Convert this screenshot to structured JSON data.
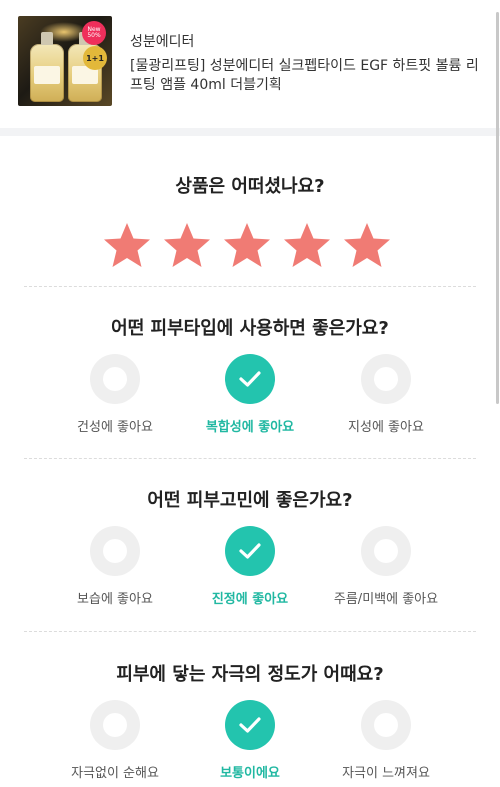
{
  "product": {
    "brand": "성분에디터",
    "name": "[물광리프팅] 성분에디터 실크펩타이드 EGF 하트핏 볼륨 리프팅 앰플 40ml 더블기획",
    "badge_new": "New 50%",
    "badge_plus": "1+1"
  },
  "rating": {
    "question": "상품은 어떠셨나요?",
    "value": 5,
    "max": 5,
    "star_color": "#f07b74"
  },
  "questions": [
    {
      "question": "어떤 피부타입에 사용하면 좋은가요?",
      "options": [
        {
          "label": "건성에 좋아요",
          "selected": false
        },
        {
          "label": "복합성에 좋아요",
          "selected": true
        },
        {
          "label": "지성에 좋아요",
          "selected": false
        }
      ]
    },
    {
      "question": "어떤 피부고민에 좋은가요?",
      "options": [
        {
          "label": "보습에 좋아요",
          "selected": false
        },
        {
          "label": "진정에 좋아요",
          "selected": true
        },
        {
          "label": "주름/미백에 좋아요",
          "selected": false
        }
      ]
    },
    {
      "question": "피부에 닿는 자극의 정도가 어때요?",
      "options": [
        {
          "label": "자극없이 순해요",
          "selected": false
        },
        {
          "label": "보통이에요",
          "selected": true
        },
        {
          "label": "자극이 느껴져요",
          "selected": false
        }
      ]
    }
  ],
  "colors": {
    "accent": "#23c4ae",
    "accent_text": "#21b8a2",
    "unselected": "#efefef"
  }
}
